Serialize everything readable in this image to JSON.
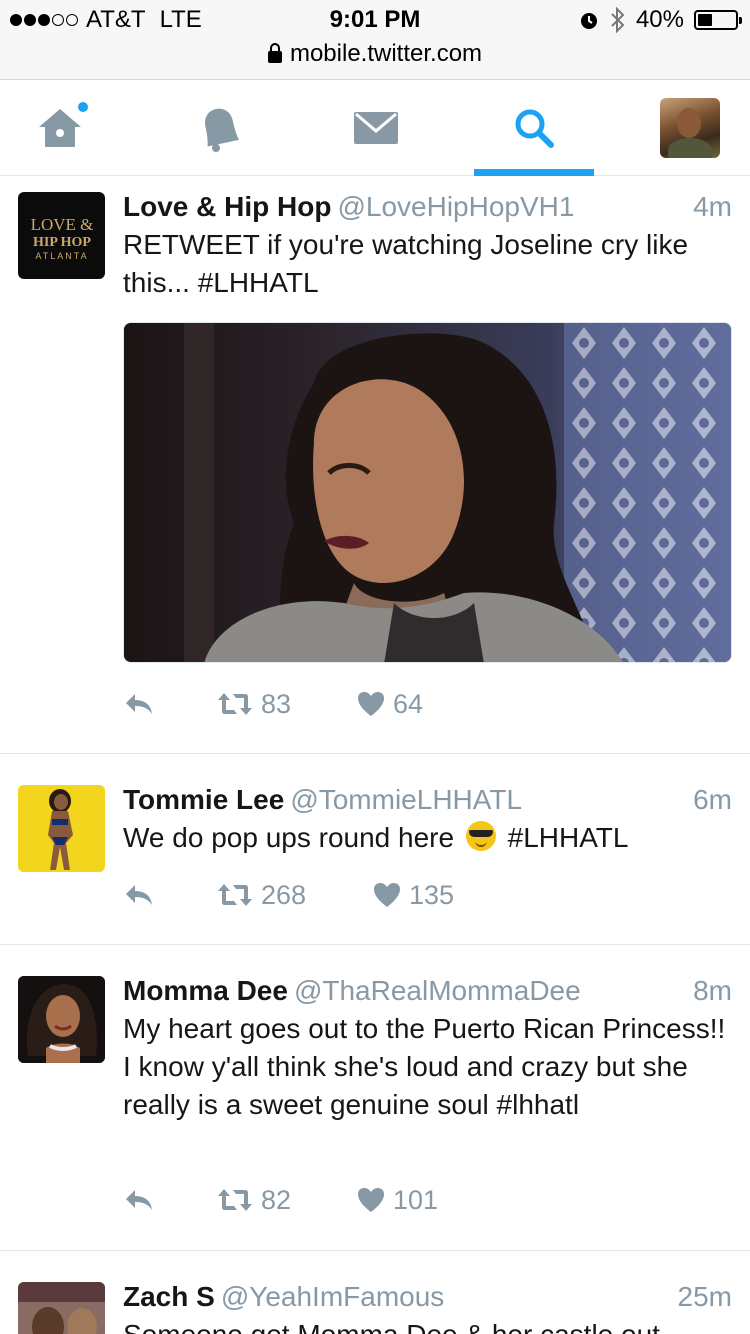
{
  "status_bar": {
    "carrier": "AT&T",
    "network": "LTE",
    "time": "9:01 PM",
    "battery": "40%",
    "battery_level": 0.4,
    "url": "mobile.twitter.com"
  },
  "nav": {
    "tabs": [
      {
        "name": "home",
        "icon": "home-icon",
        "has_notification": true
      },
      {
        "name": "notifications",
        "icon": "bell-icon"
      },
      {
        "name": "messages",
        "icon": "envelope-icon"
      },
      {
        "name": "search",
        "icon": "search-icon",
        "active": true
      },
      {
        "name": "profile",
        "icon": "profile-avatar"
      }
    ],
    "accent": "#1da1f2"
  },
  "tweets": [
    {
      "name": "Love & Hip Hop",
      "handle": "@LoveHipHopVH1",
      "time": "4m",
      "text": "RETWEET if you're watching Joseline cry like this... #LHHATL",
      "logo_text": "LOVE & HIP HOP ATLANTA",
      "retweets": "83",
      "likes": "64"
    },
    {
      "name": "Tommie Lee",
      "handle": "@TommieLHHATL",
      "time": "6m",
      "text_before": "We do pop ups round here",
      "text_after": "#LHHATL",
      "retweets": "268",
      "likes": "135"
    },
    {
      "name": "Momma Dee",
      "handle": "@ThaRealMommaDee",
      "time": "8m",
      "text": "My heart goes out to the Puerto Rican Princess!! I know y'all think she's loud and crazy but she really is a sweet genuine soul #lhhatl",
      "retweets": "82",
      "likes": "101"
    },
    {
      "name": "Zach S",
      "handle": "@YeahImFamous",
      "time": "25m",
      "text": "Someone get Momma Dee & her castle out"
    }
  ]
}
